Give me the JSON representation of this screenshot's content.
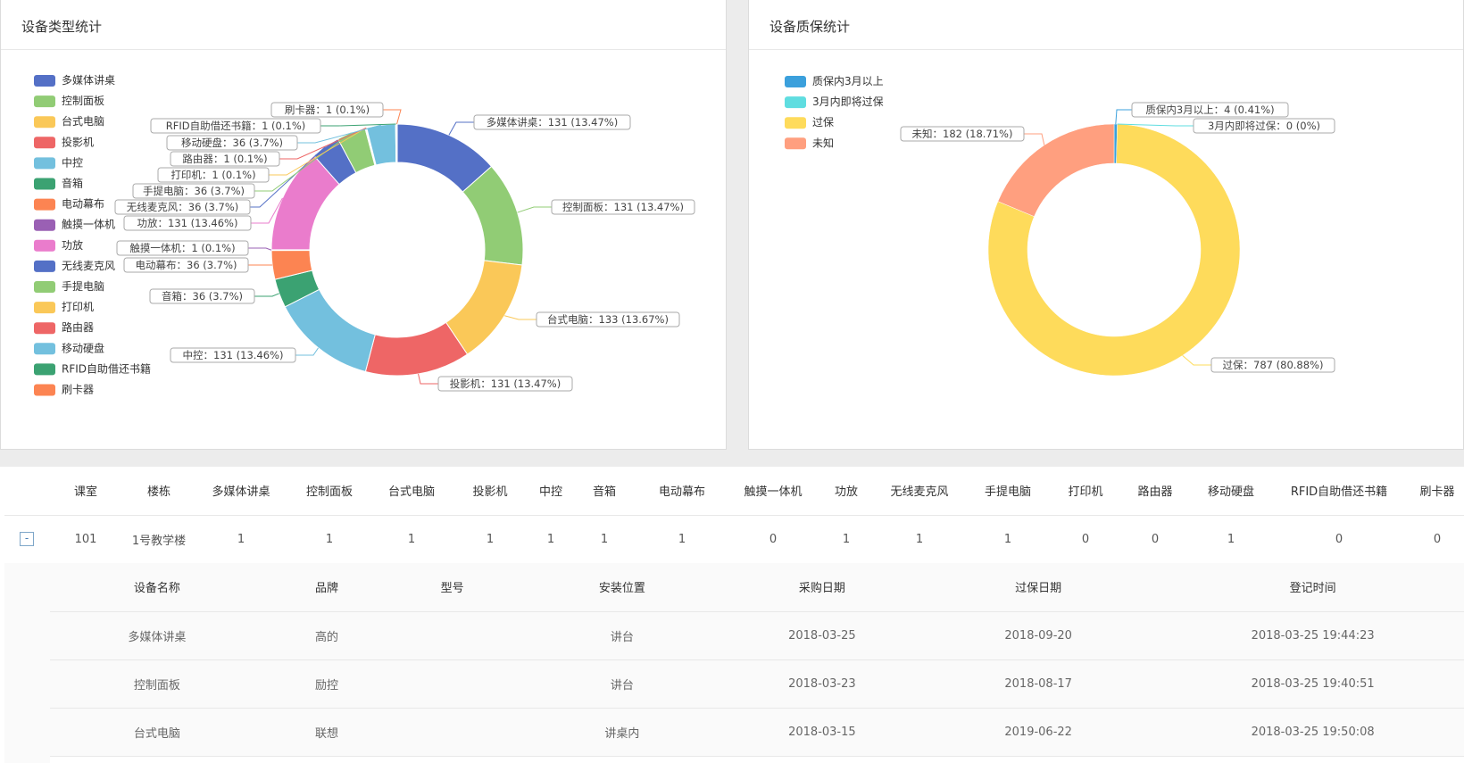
{
  "type_panel": {
    "title": "设备类型统计"
  },
  "warranty_panel": {
    "title": "设备质保统计"
  },
  "chart_data": [
    {
      "type": "pie",
      "title": "设备类型统计",
      "donut": true,
      "label_format": "{name}：{value} ({percent}%)",
      "slices": [
        {
          "name": "多媒体讲桌",
          "value": 131,
          "percent": "13.47",
          "color": "#5470c6"
        },
        {
          "name": "控制面板",
          "value": 131,
          "percent": "13.47",
          "color": "#91cc75"
        },
        {
          "name": "台式电脑",
          "value": 133,
          "percent": "13.67",
          "color": "#fac858"
        },
        {
          "name": "投影机",
          "value": 131,
          "percent": "13.47",
          "color": "#ee6666"
        },
        {
          "name": "中控",
          "value": 131,
          "percent": "13.46",
          "color": "#73c0de"
        },
        {
          "name": "音箱",
          "value": 36,
          "percent": "3.7",
          "color": "#3ba272"
        },
        {
          "name": "电动幕布",
          "value": 36,
          "percent": "3.7",
          "color": "#fc8452"
        },
        {
          "name": "触摸一体机",
          "value": 1,
          "percent": "0.1",
          "color": "#9a60b4"
        },
        {
          "name": "功放",
          "value": 131,
          "percent": "13.46",
          "color": "#ea7ccc"
        },
        {
          "name": "无线麦克风",
          "value": 36,
          "percent": "3.7",
          "color": "#5470c6"
        },
        {
          "name": "手提电脑",
          "value": 36,
          "percent": "3.7",
          "color": "#91cc75"
        },
        {
          "name": "打印机",
          "value": 1,
          "percent": "0.1",
          "color": "#fac858"
        },
        {
          "name": "路由器",
          "value": 1,
          "percent": "0.1",
          "color": "#ee6666"
        },
        {
          "name": "移动硬盘",
          "value": 36,
          "percent": "3.7",
          "color": "#73c0de"
        },
        {
          "name": "RFID自助借还书籍",
          "value": 1,
          "percent": "0.1",
          "color": "#3ba272"
        },
        {
          "name": "刷卡器",
          "value": 1,
          "percent": "0.1",
          "color": "#fc8452"
        }
      ]
    },
    {
      "type": "pie",
      "title": "设备质保统计",
      "donut": true,
      "label_format": "{name}：{value} ({percent}%)",
      "slices": [
        {
          "name": "质保内3月以上",
          "value": 4,
          "percent": "0.41",
          "color": "#3ba0dc"
        },
        {
          "name": "3月内即将过保",
          "value": 0,
          "percent": "0",
          "color": "#5fdde0"
        },
        {
          "name": "过保",
          "value": 787,
          "percent": "80.88",
          "color": "#fedb5b"
        },
        {
          "name": "未知",
          "value": 182,
          "percent": "18.71",
          "color": "#ff9f7f"
        }
      ]
    }
  ],
  "table": {
    "headers": [
      "",
      "课室",
      "楼栋",
      "多媒体讲桌",
      "控制面板",
      "台式电脑",
      "投影机",
      "中控",
      "音箱",
      "电动幕布",
      "触摸一体机",
      "功放",
      "无线麦克风",
      "手提电脑",
      "打印机",
      "路由器",
      "移动硬盘",
      "RFID自助借还书籍",
      "刷卡器"
    ],
    "rows": [
      [
        "-",
        "101",
        "1号教学楼",
        "1",
        "1",
        "1",
        "1",
        "1",
        "1",
        "1",
        "0",
        "1",
        "1",
        "1",
        "0",
        "0",
        "1",
        "0",
        "0"
      ]
    ]
  },
  "detail_table": {
    "headers": [
      "设备名称",
      "品牌",
      "型号",
      "安装位置",
      "采购日期",
      "过保日期",
      "登记时间"
    ],
    "rows": [
      [
        "多媒体讲桌",
        "高的",
        "",
        "讲台",
        "2018-03-25",
        "2018-09-20",
        "2018-03-25 19:44:23"
      ],
      [
        "控制面板",
        "励控",
        "",
        "讲台",
        "2018-03-23",
        "2018-08-17",
        "2018-03-25 19:40:51"
      ],
      [
        "台式电脑",
        "联想",
        "",
        "讲桌内",
        "2018-03-15",
        "2019-06-22",
        "2018-03-25 19:50:08"
      ]
    ]
  }
}
